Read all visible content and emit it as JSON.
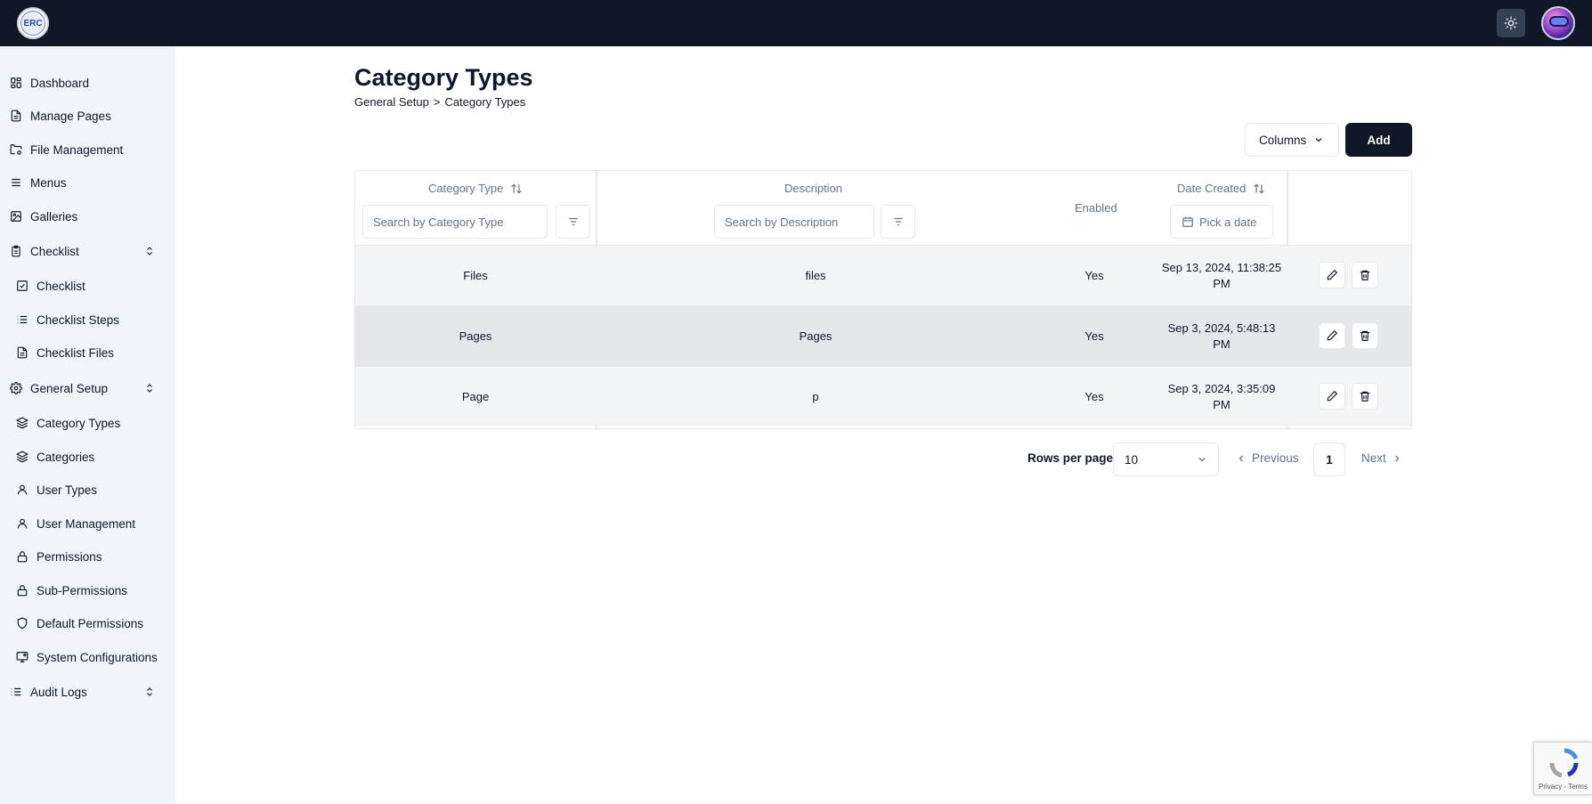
{
  "header": {
    "logo_text": "ERC",
    "theme_icon": "sun-icon",
    "avatar": "user-avatar"
  },
  "sidebar": {
    "items": [
      {
        "label": "Dashboard",
        "icon": "dashboard-icon"
      },
      {
        "label": "Manage Pages",
        "icon": "file-text-icon"
      },
      {
        "label": "File Management",
        "icon": "folder-cog-icon"
      },
      {
        "label": "Menus",
        "icon": "menu-icon"
      },
      {
        "label": "Galleries",
        "icon": "image-icon"
      },
      {
        "label": "Checklist",
        "icon": "clipboard-icon",
        "expandable": true
      },
      {
        "label": "Checklist",
        "icon": "check-square-icon"
      },
      {
        "label": "Checklist Steps",
        "icon": "list-icon"
      },
      {
        "label": "Checklist Files",
        "icon": "file-icon"
      },
      {
        "label": "General Setup",
        "icon": "gear-icon",
        "expandable": true
      },
      {
        "label": "Category Types",
        "icon": "layers-icon"
      },
      {
        "label": "Categories",
        "icon": "layers-icon"
      },
      {
        "label": "User Types",
        "icon": "user-icon"
      },
      {
        "label": "User Management",
        "icon": "user-icon"
      },
      {
        "label": "Permissions",
        "icon": "lock-icon"
      },
      {
        "label": "Sub-Permissions",
        "icon": "lock-icon"
      },
      {
        "label": "Default Permissions",
        "icon": "shield-icon"
      },
      {
        "label": "System Configurations",
        "icon": "monitor-cog-icon"
      },
      {
        "label": "Audit Logs",
        "icon": "list-tree-icon",
        "expandable": true
      }
    ]
  },
  "page": {
    "title": "Category Types",
    "breadcrumb": [
      "General Setup",
      ">",
      "Category Types"
    ]
  },
  "toolbar": {
    "columns_label": "Columns",
    "add_label": "Add"
  },
  "table": {
    "headers": {
      "category_type": "Category Type",
      "description": "Description",
      "enabled": "Enabled",
      "date_created": "Date Created"
    },
    "filters": {
      "category_type_placeholder": "Search by Category Type",
      "description_placeholder": "Search by Description",
      "date_placeholder": "Pick a date"
    },
    "rows": [
      {
        "category_type": "Files",
        "description": "files",
        "enabled": "Yes",
        "date_line1": "Sep 13, 2024, 11:38:25",
        "date_line2": "PM"
      },
      {
        "category_type": "Pages",
        "description": "Pages",
        "enabled": "Yes",
        "date_line1": "Sep 3, 2024, 5:48:13",
        "date_line2": "PM"
      },
      {
        "category_type": "Page",
        "description": "p",
        "enabled": "Yes",
        "date_line1": "Sep 3, 2024, 3:35:09",
        "date_line2": "PM"
      }
    ]
  },
  "pagination": {
    "rows_per_page_label": "Rows per page",
    "rows_per_page_value": "10",
    "previous_label": "Previous",
    "current_page": "1",
    "next_label": "Next"
  },
  "recaptcha": {
    "terms": "Privacy - Terms"
  },
  "colors": {
    "topbar": "#101828",
    "sidebar": "#f1f5f9",
    "primary_button": "#101828",
    "row_highlight": "#e5e7eb",
    "row_alt": "#f3f4f6"
  }
}
